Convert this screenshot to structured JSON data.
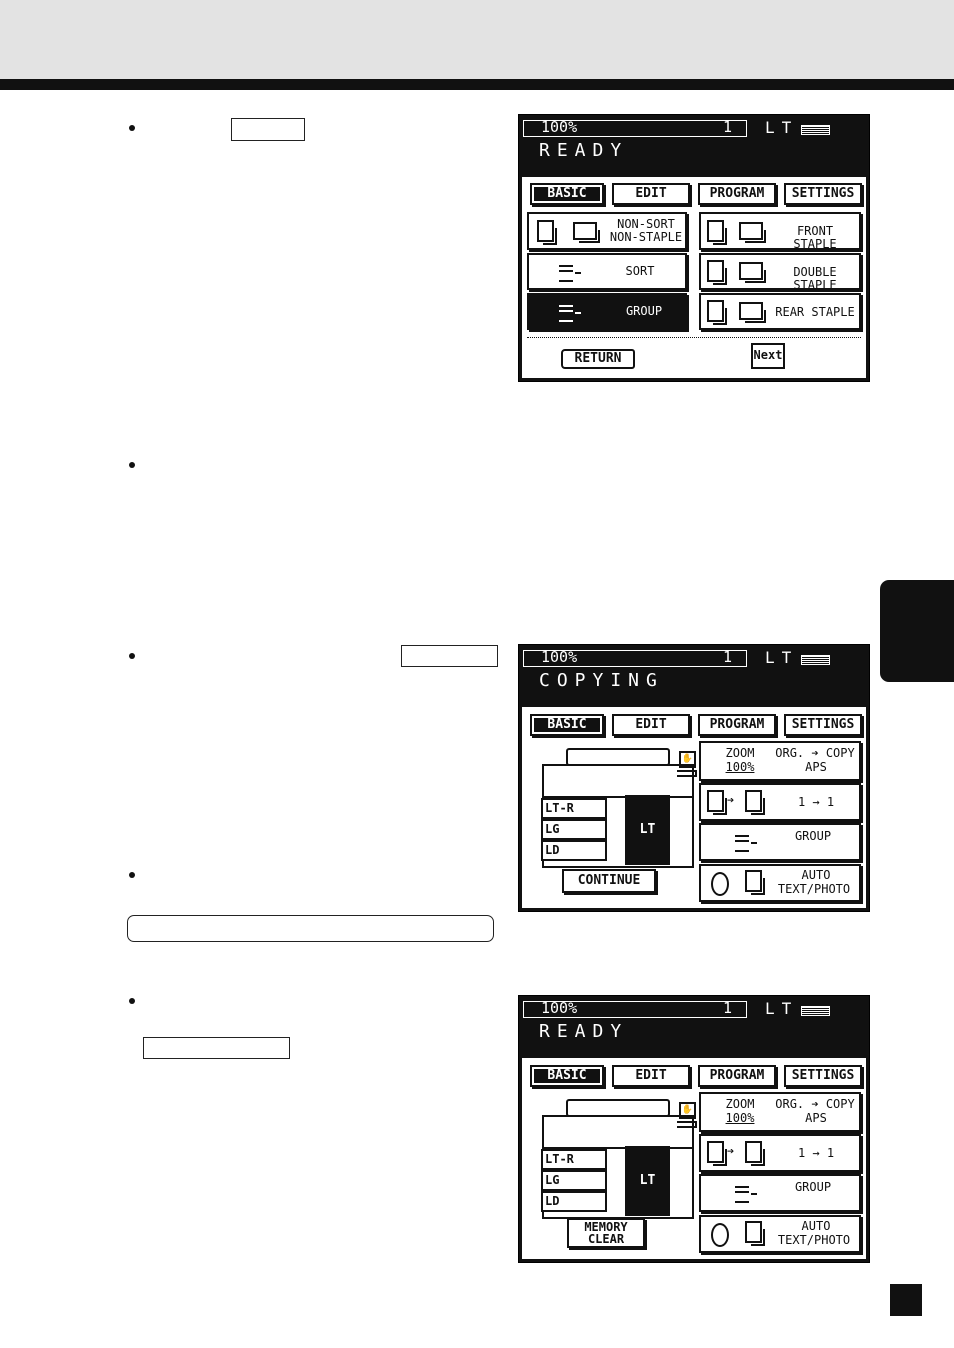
{
  "header": {},
  "page_number": "",
  "keys": {
    "key1": "",
    "key2": "",
    "key3": ""
  },
  "panels": [
    {
      "counter_zoom": "100%",
      "counter_count": "1",
      "paper_size": "LT",
      "status": "READY",
      "tabs": [
        "BASIC",
        "EDIT",
        "PROGRAM",
        "SETTINGS"
      ],
      "buttons": {
        "non_sort_line1": "NON-SORT",
        "non_sort_line2": "NON-STAPLE",
        "sort": "SORT",
        "group": "GROUP",
        "front_staple": "FRONT STAPLE",
        "double_staple": "DOUBLE STAPLE",
        "rear_staple": "REAR STAPLE"
      },
      "return_label": "RETURN",
      "next_label": "Next"
    },
    {
      "counter_zoom": "100%",
      "counter_count": "1",
      "paper_size": "LT",
      "status": "COPYING",
      "tabs": [
        "BASIC",
        "EDIT",
        "PROGRAM",
        "SETTINGS"
      ],
      "zoom_label": "ZOOM",
      "zoom_value": "100%",
      "org_copy": "ORG. ➔ COPY",
      "aps": "APS",
      "duplex_mode": "1 → 1",
      "finishing": "GROUP",
      "exposure_line1": "AUTO",
      "exposure_line2": "TEXT/PHOTO",
      "trays": [
        "LT-R",
        "LG",
        "LD"
      ],
      "selected_tray": "LT",
      "action_line1": "CONTINUE",
      "action_line2": ""
    },
    {
      "counter_zoom": "100%",
      "counter_count": "1",
      "paper_size": "LT",
      "status": "READY",
      "tabs": [
        "BASIC",
        "EDIT",
        "PROGRAM",
        "SETTINGS"
      ],
      "zoom_label": "ZOOM",
      "zoom_value": "100%",
      "org_copy": "ORG. ➔ COPY",
      "aps": "APS",
      "duplex_mode": "1 → 1",
      "finishing": "GROUP",
      "exposure_line1": "AUTO",
      "exposure_line2": "TEXT/PHOTO",
      "trays": [
        "LT-R",
        "LG",
        "LD"
      ],
      "selected_tray": "LT",
      "action_line1": "MEMORY",
      "action_line2": "CLEAR"
    }
  ]
}
